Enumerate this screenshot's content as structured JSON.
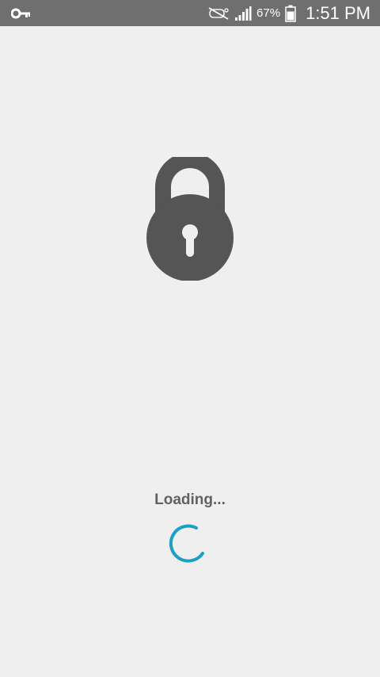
{
  "status_bar": {
    "battery_percent": "67%",
    "time": "1:51 PM",
    "icons": {
      "left": "key-icon",
      "right": [
        "mute-icon",
        "signal-icon",
        "battery-icon"
      ]
    }
  },
  "main": {
    "icon": "lock-icon",
    "loading_text": "Loading..."
  },
  "colors": {
    "background": "#efefef",
    "status_bar": "#6f6f6f",
    "lock": "#555555",
    "loading_text": "#616161",
    "spinner": "#1aa0c2"
  }
}
